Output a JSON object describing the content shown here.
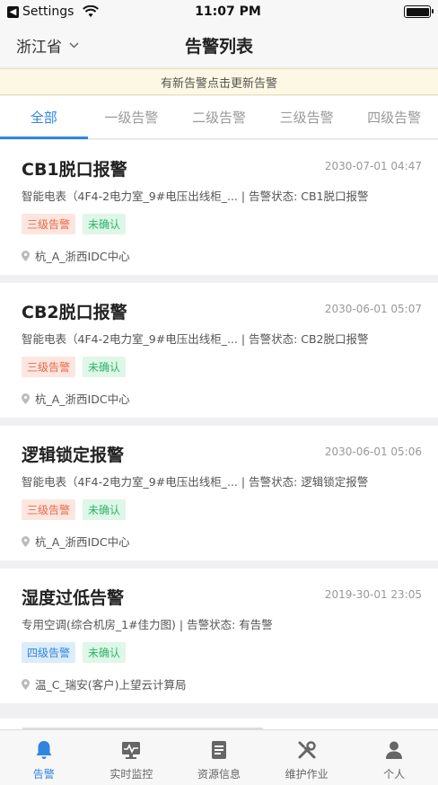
{
  "status_bar": {
    "back_label": "Settings",
    "time": "11:07 PM"
  },
  "nav": {
    "region": "浙江省",
    "title": "告警列表"
  },
  "notice": {
    "text": "有新告警点击更新告警"
  },
  "tabs": [
    {
      "label": "全部",
      "active": true
    },
    {
      "label": "一级告警",
      "active": false
    },
    {
      "label": "二级告警",
      "active": false
    },
    {
      "label": "三级告警",
      "active": false
    },
    {
      "label": "四级告警",
      "active": false
    }
  ],
  "alarms": [
    {
      "title": "CB1脱口报警",
      "time": "2030-07-01 04:47",
      "desc": "智能电表（4F4-2电力室_9#电压出线柜_...  |  告警状态: CB1脱口报警",
      "level_tag": "三级告警",
      "status_tag": "未确认",
      "location": "杭_A_浙西IDC中心"
    },
    {
      "title": "CB2脱口报警",
      "time": "2030-06-01 05:07",
      "desc": "智能电表（4F4-2电力室_9#电压出线柜_...  |  告警状态: CB2脱口报警",
      "level_tag": "三级告警",
      "status_tag": "未确认",
      "location": "杭_A_浙西IDC中心"
    },
    {
      "title": "逻辑锁定报警",
      "time": "2030-06-01 05:06",
      "desc": "智能电表（4F4-2电力室_9#电压出线柜_...  |  告警状态: 逻辑锁定报警",
      "level_tag": "三级告警",
      "status_tag": "未确认",
      "location": "杭_A_浙西IDC中心"
    },
    {
      "title": "湿度过低告警",
      "time": "2019-30-01 23:05",
      "desc": "专用空调(综合机房_1#佳力图)  |  告警状态: 有告警",
      "level_tag": "四级告警",
      "status_tag": "未确认",
      "location": "温_C_瑞安(客户)上望云计算局"
    }
  ],
  "bottom_nav": [
    {
      "label": "告警",
      "icon": "bell-icon",
      "active": true
    },
    {
      "label": "实时监控",
      "icon": "monitor-icon",
      "active": false
    },
    {
      "label": "资源信息",
      "icon": "document-icon",
      "active": false
    },
    {
      "label": "维护作业",
      "icon": "tools-icon",
      "active": false
    },
    {
      "label": "个人",
      "icon": "person-icon",
      "active": false
    }
  ],
  "colors": {
    "accent": "#2f86e0",
    "level3": "#e86a4a",
    "level4": "#2f86e0",
    "unconfirmed": "#2fb36b",
    "notice_bg": "#fdf8e4"
  }
}
